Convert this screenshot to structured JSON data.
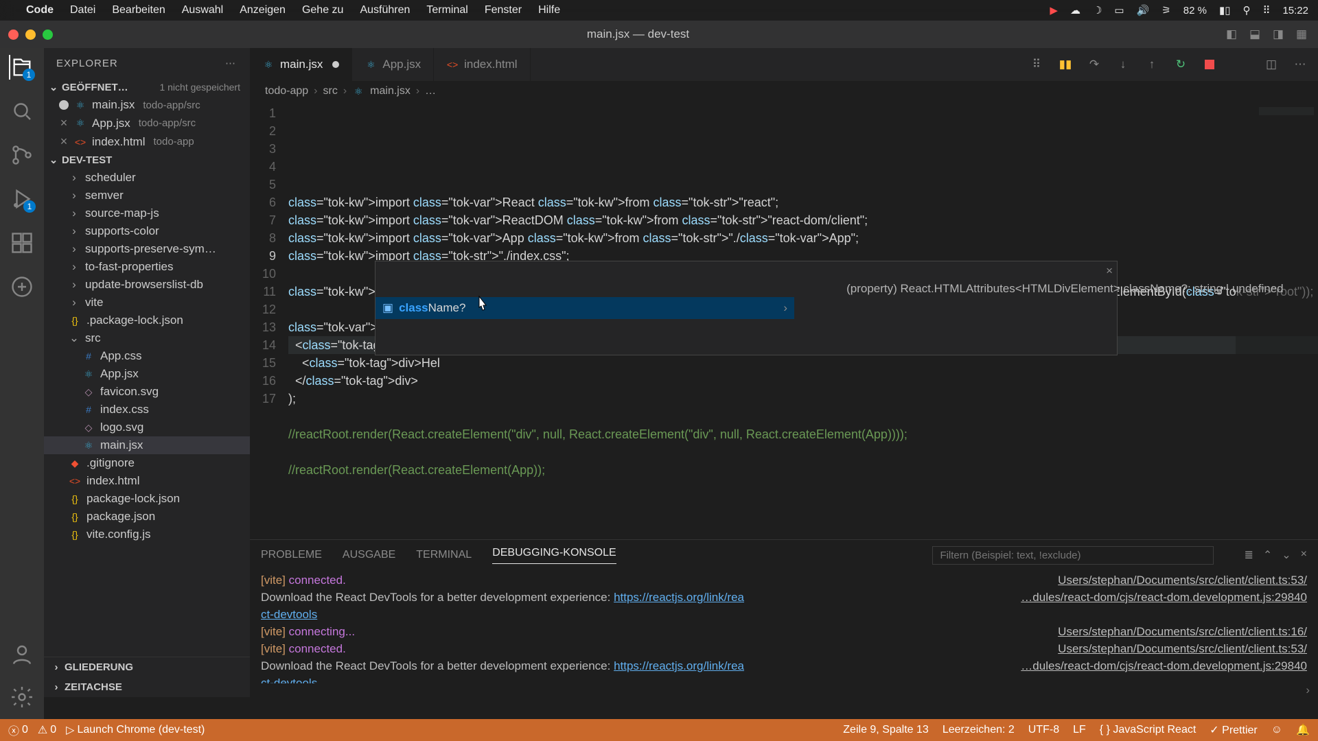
{
  "mac_menu": {
    "app": "Code",
    "items": [
      "Datei",
      "Bearbeiten",
      "Auswahl",
      "Anzeigen",
      "Gehe zu",
      "Ausführen",
      "Terminal",
      "Fenster",
      "Hilfe"
    ],
    "status": {
      "battery_pct": "82 %",
      "time": "15:22"
    }
  },
  "window": {
    "title": "main.jsx — dev-test"
  },
  "activitybar": {
    "explorer_badge": "1",
    "debug_badge": "1"
  },
  "sidebar": {
    "title": "EXPLORER",
    "sections": {
      "open_editors": {
        "label": "GEÖFFNET…",
        "hint": "1 nicht gespeichert",
        "items": [
          {
            "name": "main.jsx",
            "path": "todo-app/src",
            "dirty": true
          },
          {
            "name": "App.jsx",
            "path": "todo-app/src",
            "dirty": false
          },
          {
            "name": "index.html",
            "path": "todo-app",
            "dirty": false
          }
        ]
      },
      "project": {
        "label": "DEV-TEST",
        "items": [
          {
            "name": "scheduler",
            "type": "folder"
          },
          {
            "name": "semver",
            "type": "folder"
          },
          {
            "name": "source-map-js",
            "type": "folder"
          },
          {
            "name": "supports-color",
            "type": "folder"
          },
          {
            "name": "supports-preserve-sym…",
            "type": "folder"
          },
          {
            "name": "to-fast-properties",
            "type": "folder"
          },
          {
            "name": "update-browserslist-db",
            "type": "folder"
          },
          {
            "name": "vite",
            "type": "folder"
          },
          {
            "name": ".package-lock.json",
            "type": "json"
          },
          {
            "name": "src",
            "type": "folder-open"
          },
          {
            "name": "App.css",
            "type": "css",
            "indent": 2
          },
          {
            "name": "App.jsx",
            "type": "react",
            "indent": 2
          },
          {
            "name": "favicon.svg",
            "type": "svg",
            "indent": 2
          },
          {
            "name": "index.css",
            "type": "css",
            "indent": 2
          },
          {
            "name": "logo.svg",
            "type": "svg",
            "indent": 2
          },
          {
            "name": "main.jsx",
            "type": "react",
            "indent": 2,
            "selected": true
          },
          {
            "name": ".gitignore",
            "type": "git"
          },
          {
            "name": "index.html",
            "type": "html"
          },
          {
            "name": "package-lock.json",
            "type": "json"
          },
          {
            "name": "package.json",
            "type": "json"
          },
          {
            "name": "vite.config.js",
            "type": "json"
          }
        ]
      },
      "outline": "GLIEDERUNG",
      "timeline": "ZEITACHSE"
    }
  },
  "tabs": [
    {
      "label": "main.jsx",
      "active": true,
      "dirty": true,
      "ico": "react"
    },
    {
      "label": "App.jsx",
      "active": false,
      "ico": "react"
    },
    {
      "label": "index.html",
      "active": false,
      "ico": "html"
    }
  ],
  "breadcrumb": [
    "todo-app",
    "src",
    "main.jsx",
    "…"
  ],
  "code": {
    "lines": [
      "import React from \"react\";",
      "import ReactDOM from \"react-dom/client\";",
      "import App from \"./App\";",
      "import \"./index.css\";",
      "",
      "const reactRoot = ReactDOM.createRoot(document.getElementById(\"root\"));",
      "",
      "reactRoot.render(",
      "  <div class",
      "    <div>Hel",
      "  </div>",
      ");",
      "",
      "//reactRoot.render(React.createElement(\"div\", null, React.createElement(\"div\", null, React.createElement(App))));",
      "",
      "//reactRoot.render(React.createElement(App));",
      ""
    ],
    "current_line": 9
  },
  "suggest": {
    "match_prefix": "class",
    "match_suffix": "Name?",
    "detail": "(property) React.HTMLAttributes<HTMLDivElement>.className?: string | undefined"
  },
  "panel": {
    "tabs": [
      "PROBLEME",
      "AUSGABE",
      "TERMINAL",
      "DEBUGGING-KONSOLE"
    ],
    "active": "DEBUGGING-KONSOLE",
    "filter_placeholder": "Filtern (Beispiel: text, !exclude)",
    "lines": [
      {
        "tag": "[vite]",
        "msg": "connected.",
        "src": "Users/stephan/Documents/src/client/client.ts:53/"
      },
      {
        "msg": "Download the React DevTools for a better development experience: https://reactjs.org/link/rea",
        "src": "…dules/react-dom/cjs/react-dom.development.js:29840",
        "wrap": "ct-devtools"
      },
      {
        "tag": "[vite]",
        "msg": "connecting...",
        "src": "Users/stephan/Documents/src/client/client.ts:16/"
      },
      {
        "tag": "[vite]",
        "msg": "connected.",
        "src": "Users/stephan/Documents/src/client/client.ts:53/"
      },
      {
        "msg": "Download the React DevTools for a better development experience: https://reactjs.org/link/rea",
        "src": "…dules/react-dom/cjs/react-dom.development.js:29840",
        "wrap": "ct-devtools"
      }
    ]
  },
  "status": {
    "errors": "0",
    "warnings": "0",
    "launch": "Launch Chrome (dev-test)",
    "pos": "Zeile 9, Spalte 13",
    "spaces": "Leerzeichen: 2",
    "enc": "UTF-8",
    "eol": "LF",
    "lang": "JavaScript React",
    "prettier": "Prettier"
  }
}
